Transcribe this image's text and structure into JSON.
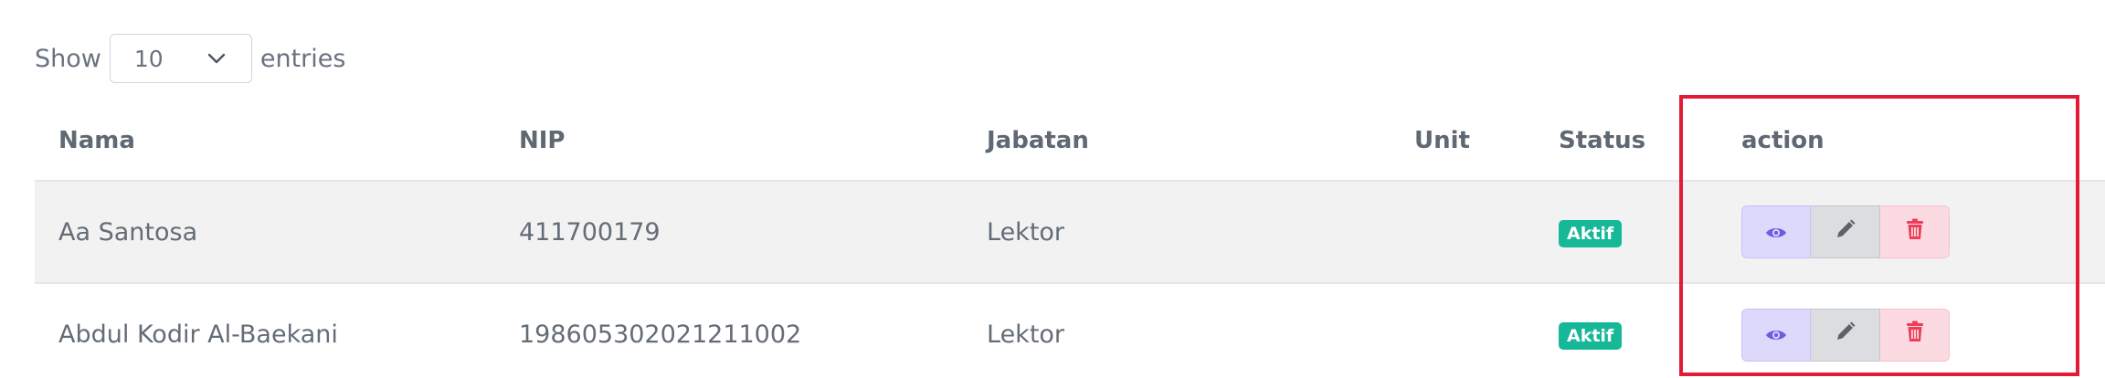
{
  "length_control": {
    "prefix": "Show",
    "selected": "10",
    "suffix": "entries"
  },
  "table": {
    "headers": [
      "Nama",
      "NIP",
      "Jabatan",
      "Unit",
      "Status",
      "action"
    ],
    "rows": [
      {
        "nama": "Aa Santosa",
        "nip": "411700179",
        "jabatan": "Lektor",
        "unit": "",
        "status": "Aktif"
      },
      {
        "nama": "Abdul Kodir Al-Baekani",
        "nip": "198605302021211002",
        "jabatan": "Lektor",
        "unit": "",
        "status": "Aktif"
      }
    ]
  },
  "icons": {
    "view": "eye-icon",
    "edit": "pencil-icon",
    "delete": "trash-icon",
    "dropdown": "chevron-down-icon"
  },
  "colors": {
    "status_badge": "#17b897",
    "view_button": "#ddd9fb",
    "view_icon": "#6f5be3",
    "edit_button": "#dcdde0",
    "edit_icon": "#5d6168",
    "delete_button": "#fbdbe1",
    "delete_icon": "#ef3e57",
    "highlight": "#e21b36"
  }
}
